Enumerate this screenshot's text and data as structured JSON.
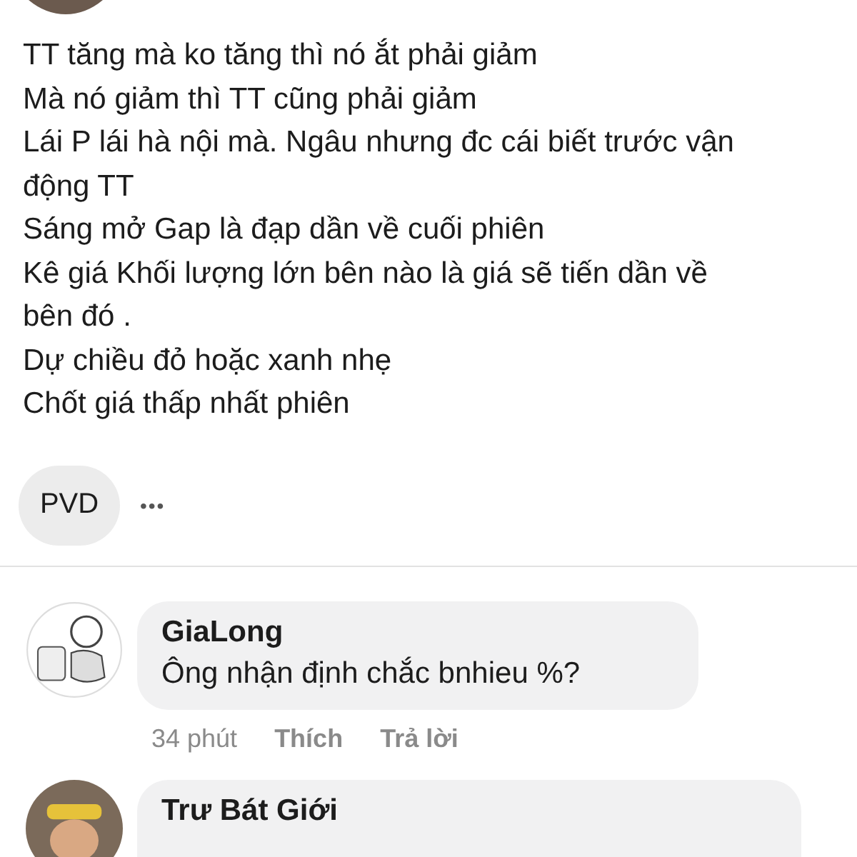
{
  "post": {
    "lines": [
      "TT tăng mà ko tăng thì nó ắt phải giảm",
      "Mà nó giảm thì TT cũng phải giảm",
      "Lái P lái hà nội mà. Ngâu nhưng đc cái biết trước vận động TT",
      "Sáng mở Gap là đạp dần về cuối phiên",
      "Kê giá Khối lượng lớn bên nào là giá sẽ tiến dần về bên đó .",
      "Dự chiều đỏ hoặc xanh nhẹ",
      "Chốt giá thấp nhất phiên"
    ],
    "tags": [
      "PVD"
    ],
    "more": "•••"
  },
  "comments": [
    {
      "author": "GiaLong",
      "text": "Ông nhận định chắc bnhieu %?",
      "time": "34 phút",
      "like": "Thích",
      "reply": "Trả lời"
    },
    {
      "author": "Trư Bát Giới"
    }
  ]
}
